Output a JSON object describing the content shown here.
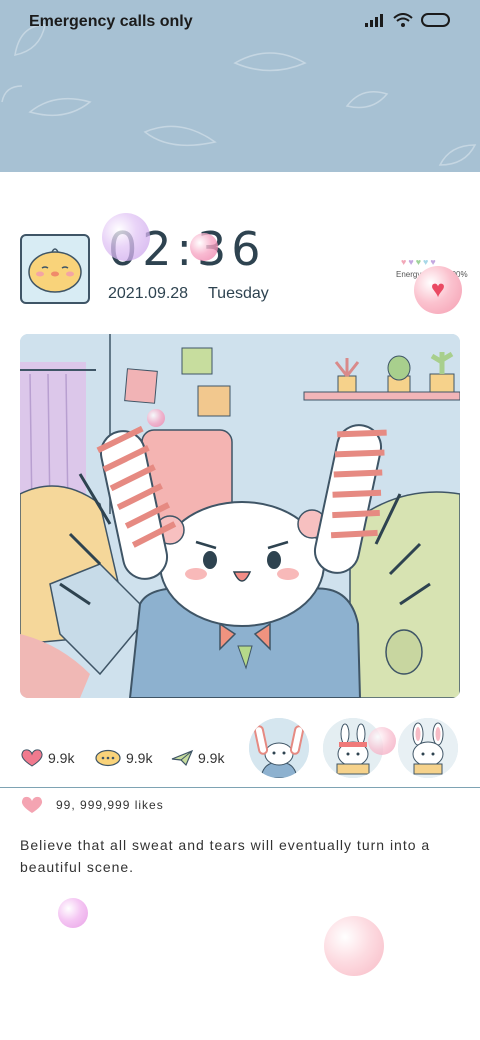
{
  "status_bar": {
    "carrier_text": "Emergency calls only",
    "icons": [
      "signal-icon",
      "wifi-icon",
      "battery-icon"
    ]
  },
  "widget": {
    "clock": "02:36",
    "date": "2021.09.28",
    "weekday": "Tuesday",
    "energy_label": "Energy value: 100%",
    "energy_hearts": [
      "#f2a8b8",
      "#c4a8e0",
      "#9fd39a",
      "#a8d8e8",
      "#c4a8e0"
    ]
  },
  "stats": {
    "hearts": "9.9k",
    "comments": "9.9k",
    "shares": "9.9k"
  },
  "likes": "99, 999,999 likes",
  "quote": "Believe that all sweat and tears will eventually turn into a beautiful scene.",
  "colors": {
    "top_band": "#a7c1d3",
    "accent_pink": "#f07a8e",
    "text_dark": "#2e4350"
  }
}
